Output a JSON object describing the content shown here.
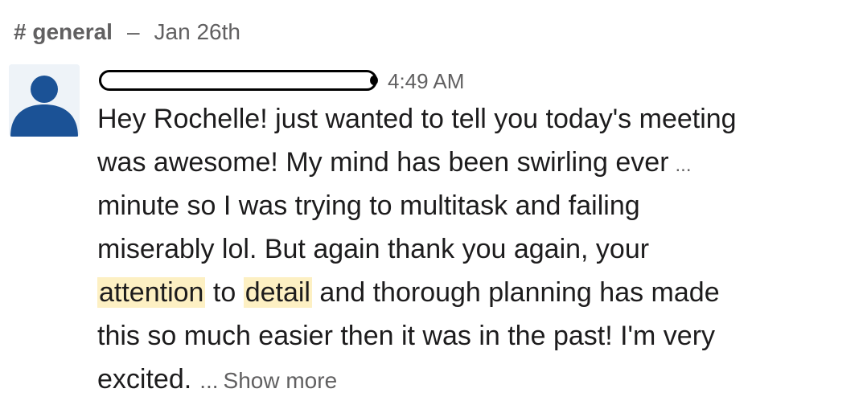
{
  "channel": {
    "hash": "#",
    "name": "general",
    "separator": "–",
    "date": "Jan 26th"
  },
  "message": {
    "timestamp": "4:49 AM",
    "lines": {
      "l1": "Hey Rochelle! just wanted to tell you today's meeting",
      "l2": "was awesome! My mind has been swirling ever",
      "l2_ellipsis": "...",
      "l3": "minute so I was trying to multitask and failing",
      "l4": "miserably lol. But again thank you again, your",
      "l5_h1": "attention",
      "l5_mid": " to ",
      "l5_h2": "detail",
      "l5_rest": " and thorough planning has made",
      "l6": "this so much easier then it was in the past! I'm very",
      "l7": "excited."
    },
    "more_ellipsis": "...",
    "show_more_label": "Show more"
  },
  "colors": {
    "highlight": "#fdf0c3",
    "muted_text": "#616061",
    "body_text": "#1d1c1d",
    "avatar_bg": "#eef3f8",
    "avatar_icon": "#1b5296"
  },
  "icons": {
    "avatar": "user-silhouette-icon"
  }
}
